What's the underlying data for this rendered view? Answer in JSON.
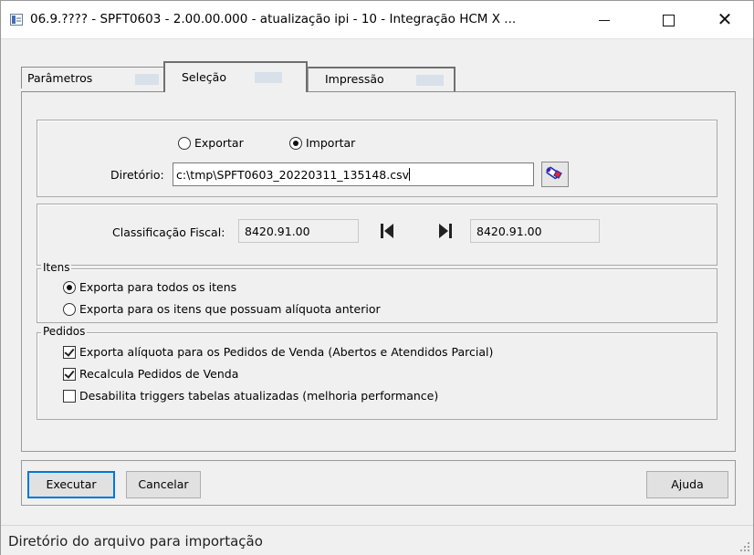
{
  "window": {
    "title": "06.9.???? - SPFT0603 - 2.00.00.000 - atualização ipi - 10 - Integração HCM X ...",
    "minimize_label": "—",
    "maximize_label": "",
    "close_label": "✕"
  },
  "tabs": [
    {
      "label": "Parâmetros",
      "selected": false
    },
    {
      "label": "Seleção",
      "selected": true
    },
    {
      "label": "Impressão",
      "selected": false
    }
  ],
  "mode": {
    "export_label": "Exportar",
    "import_label": "Importar",
    "selected": "Importar"
  },
  "directory": {
    "label": "Diretório:",
    "value": "c:\\tmp\\SPFT0603_20220311_135148.csv",
    "browse_icon": "flashlight-search-icon"
  },
  "classification": {
    "label": "Classificação Fiscal:",
    "from": "8420.91.00",
    "to": "8420.91.00",
    "first_icon": "skip-to-first-icon",
    "last_icon": "skip-to-last-icon"
  },
  "items_group": {
    "legend": "Itens",
    "options": [
      {
        "label": "Exporta para todos os itens",
        "selected": true
      },
      {
        "label": "Exporta para os itens que possuam alíquota anterior",
        "selected": false
      }
    ]
  },
  "orders_group": {
    "legend": "Pedidos",
    "options": [
      {
        "label": "Exporta alíquota para os Pedidos de Venda (Abertos e Atendidos Parcial)",
        "checked": true
      },
      {
        "label": "Recalcula Pedidos de Venda",
        "checked": true
      },
      {
        "label": "Desabilita triggers tabelas atualizadas (melhoria performance)",
        "checked": false
      }
    ]
  },
  "buttons": {
    "execute": "Executar",
    "cancel": "Cancelar",
    "help": "Ajuda"
  },
  "status": {
    "text": "Diretório do arquivo para importação"
  },
  "colors": {
    "accent": "#0078d7",
    "tab_fill": "#d8e0ea"
  }
}
